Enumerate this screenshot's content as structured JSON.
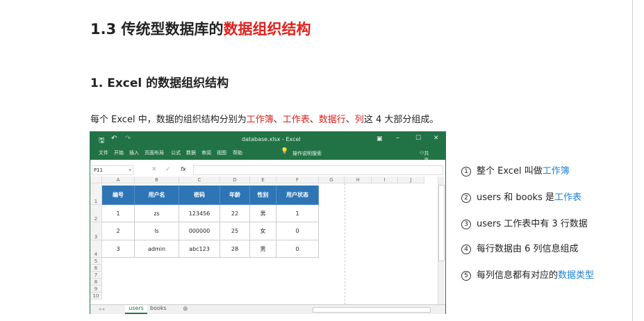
{
  "title": {
    "prefix": "1.3 传统型数据库的",
    "highlight": "数据组织结构"
  },
  "subtitle": "1. Excel 的数据组织结构",
  "paragraph": {
    "p1": "每个 Excel 中，数据的组织结构分别为",
    "t1": "工作簿",
    "s1": "、",
    "t2": "工作表",
    "s2": "、",
    "t3": "数据行",
    "s3": "、",
    "t4": "列",
    "p2": "这 4 大部分组成。"
  },
  "excel": {
    "window_title": "database.xlsx - Excel",
    "ribbon": [
      "文件",
      "开始",
      "插入",
      "页面布局",
      "公式",
      "数据",
      "审阅",
      "视图",
      "帮助"
    ],
    "tell_me": "操作说明搜索",
    "share": "共享",
    "name_box": "P11",
    "fx": "fx",
    "columns": [
      "A",
      "B",
      "C",
      "D",
      "E",
      "F",
      "G",
      "H",
      "I",
      "J"
    ],
    "rows": [
      "1",
      "2",
      "3",
      "4",
      "5",
      "6",
      "7",
      "8",
      "9",
      "10"
    ],
    "table_header": [
      "编号",
      "用户名",
      "密码",
      "年龄",
      "性别",
      "用户状态"
    ],
    "table_rows": [
      [
        "1",
        "zs",
        "123456",
        "22",
        "男",
        "1"
      ],
      [
        "2",
        "ls",
        "000000",
        "25",
        "女",
        "0"
      ],
      [
        "3",
        "admin",
        "abc123",
        "28",
        "男",
        "0"
      ]
    ],
    "sheets": [
      "users",
      "books"
    ],
    "active_sheet": "users"
  },
  "list": [
    {
      "num": "①",
      "text": "整个 Excel 叫做",
      "hl": "工作簿"
    },
    {
      "num": "②",
      "text": "users 和 books 是",
      "hl": "工作表"
    },
    {
      "num": "③",
      "text": "users 工作表中有 3 行数据",
      "hl": ""
    },
    {
      "num": "④",
      "text": "每行数据由 6 列信息组成",
      "hl": ""
    },
    {
      "num": "⑤",
      "text": "每列信息都有对应的",
      "hl": "数据类型"
    }
  ]
}
